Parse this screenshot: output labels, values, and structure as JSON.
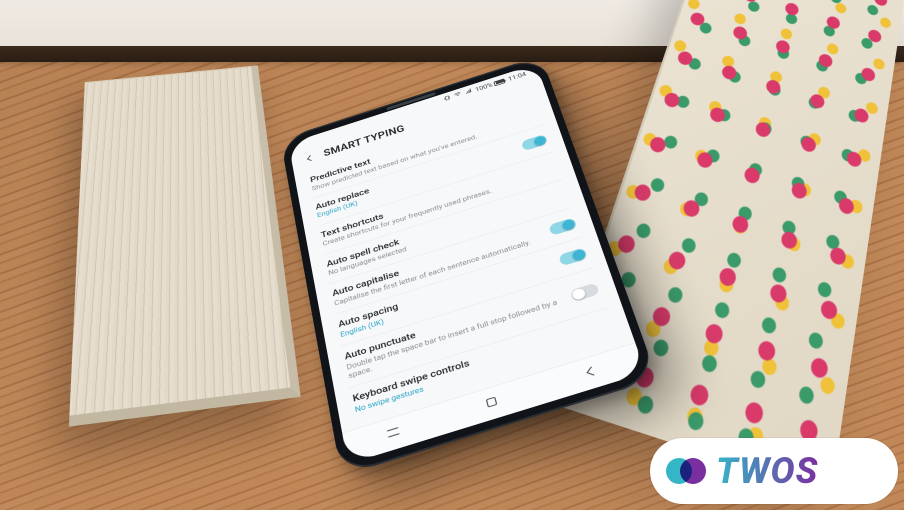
{
  "statusbar": {
    "signal": "signal-full",
    "wifi": "wifi-on",
    "battery_pct": "100%",
    "time": "11:04"
  },
  "header": {
    "title": "SMART TYPING"
  },
  "settings": [
    {
      "key": "predictive",
      "title": "Predictive text",
      "sub": "Show predicted text based on what you've entered.",
      "sub_link": false,
      "switch": null
    },
    {
      "key": "auto_replace",
      "title": "Auto replace",
      "sub": "English (UK)",
      "sub_link": true,
      "switch": "on"
    },
    {
      "key": "text_shortcuts",
      "title": "Text shortcuts",
      "sub": "Create shortcuts for your frequently used phrases.",
      "sub_link": false,
      "switch": null
    },
    {
      "key": "auto_spell",
      "title": "Auto spell check",
      "sub": "No languages selected",
      "sub_link": false,
      "switch": null
    },
    {
      "key": "auto_cap",
      "title": "Auto capitalise",
      "sub": "Capitalise the first letter of each sentence automatically.",
      "sub_link": false,
      "switch": "on"
    },
    {
      "key": "auto_spacing",
      "title": "Auto spacing",
      "sub": "English (UK)",
      "sub_link": true,
      "switch": "on"
    },
    {
      "key": "auto_punctuate",
      "title": "Auto punctuate",
      "sub": "Double tap the space bar to insert a full stop followed by a space.",
      "sub_link": false,
      "switch": "off"
    },
    {
      "key": "swipe",
      "title": "Keyboard swipe controls",
      "sub": "No swipe gestures",
      "sub_link": true,
      "switch": null
    }
  ],
  "logo": {
    "text": "TWOS"
  }
}
